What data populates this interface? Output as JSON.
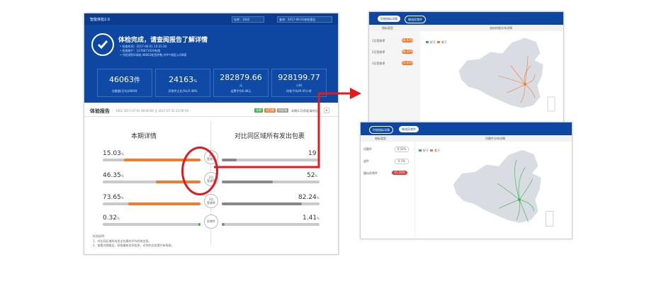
{
  "main": {
    "topbar": {
      "title": "智能体检2.0",
      "select1": "仓库：1002",
      "select2": "查询：2017-06-01体检报告"
    },
    "headline": "体检完成，请查阅报告了解详情",
    "meta": [
      "• 检查时间：2017-06-01 15:21:30",
      "• 检查账户：1276671010有限",
      "• 共检测到1场地,46063发货件数,共9个地区公司8家"
    ],
    "stats": [
      {
        "value": "46063",
        "unit": "件",
        "label": "包裹量(日均)/685件"
      },
      {
        "value": "24163",
        "unit": "%",
        "label": "异常件占比(%)/2.48%"
      },
      {
        "value": "282879.66",
        "unit": "元",
        "label": "运费平均6.48元"
      },
      {
        "value": "928199.77",
        "unit": "小时",
        "label": "时效平均49.05小时"
      }
    ],
    "report_title": "体验报告",
    "report_sub": "1002 2017-07-01 00:00:00 至 2017-07-31 23:59:59",
    "chips": [
      "本期",
      "对比期",
      "同区域"
    ],
    "filter_label": "本期(1月)同区域对比",
    "col_left": "本期详情",
    "col_right": "对比同区域所有发出包裹",
    "rows": [
      {
        "left": "15.03",
        "right": "19",
        "unit": "%",
        "mid": [
          "3日",
          "签收率"
        ],
        "left_fill": 0.78,
        "right_fill": 0.15
      },
      {
        "left": "46.35",
        "right": "52",
        "unit": "%",
        "mid": [
          "2日",
          "签收率"
        ],
        "left_fill": 0.46,
        "right_fill": 0.52
      },
      {
        "left": "73.65",
        "right": "82.24",
        "unit": "%",
        "mid": [
          "3日",
          "签收率"
        ],
        "left_fill": 0.74,
        "right_fill": 0.82
      },
      {
        "left": "0.32",
        "right": "1.41",
        "unit": "%",
        "mid": [
          "异常件"
        ],
        "left_fill": 0.02,
        "right_fill": 0.03
      }
    ],
    "notes_title": "检测说明：",
    "notes": [
      "1、对比同区域所有发出包裹的平均时效信息。",
      "2、查看详细报告，获取最新检测信息，对你的业务提升有帮助。"
    ]
  },
  "panel1": {
    "tabs": [
      "时效指标详情",
      "物流异常件"
    ],
    "head_left": "指标类型",
    "head_right": "流向时效分布详情",
    "items": [
      {
        "label": "1日签收率",
        "value": "18.03%"
      },
      {
        "label": "2日签收率",
        "value": "66.35%"
      },
      {
        "label": "3日签收率",
        "value": "73.65%"
      }
    ],
    "legend": [
      "好于",
      "差于"
    ]
  },
  "panel2": {
    "tabs": [
      "时效指标详情",
      "物流异常件"
    ],
    "head_left": "指标类型",
    "head_right": "问题件分布详情",
    "items": [
      {
        "label": "问题件",
        "value": "0.32%"
      },
      {
        "label": "退件",
        "value": "0.1%"
      },
      {
        "label": "疑似异常件",
        "value": "41.16%"
      }
    ],
    "legend": [
      "好于",
      "差于"
    ]
  },
  "colors": {
    "brand": "#0d47a1",
    "orange": "#f07c32",
    "green": "#3ab54a",
    "red": "#e5181b",
    "gray": "#c9c9c9"
  }
}
